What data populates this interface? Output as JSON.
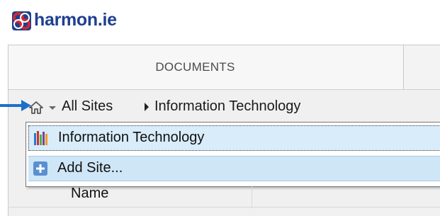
{
  "app": {
    "brand": "harmon.ie"
  },
  "tabs": {
    "documents": "DOCUMENTS"
  },
  "breadcrumb": {
    "root": "All Sites",
    "current": "Information Technology"
  },
  "dropdown": {
    "items": [
      {
        "label": "Information Technology",
        "icon": "site-icon"
      },
      {
        "label": "Add Site...",
        "icon": "plus-icon"
      }
    ]
  },
  "list": {
    "column_name": "Name"
  },
  "colors": {
    "brand": "#1f3f8f",
    "arrow": "#1e6fc8",
    "selection": "#d9ecf9"
  }
}
